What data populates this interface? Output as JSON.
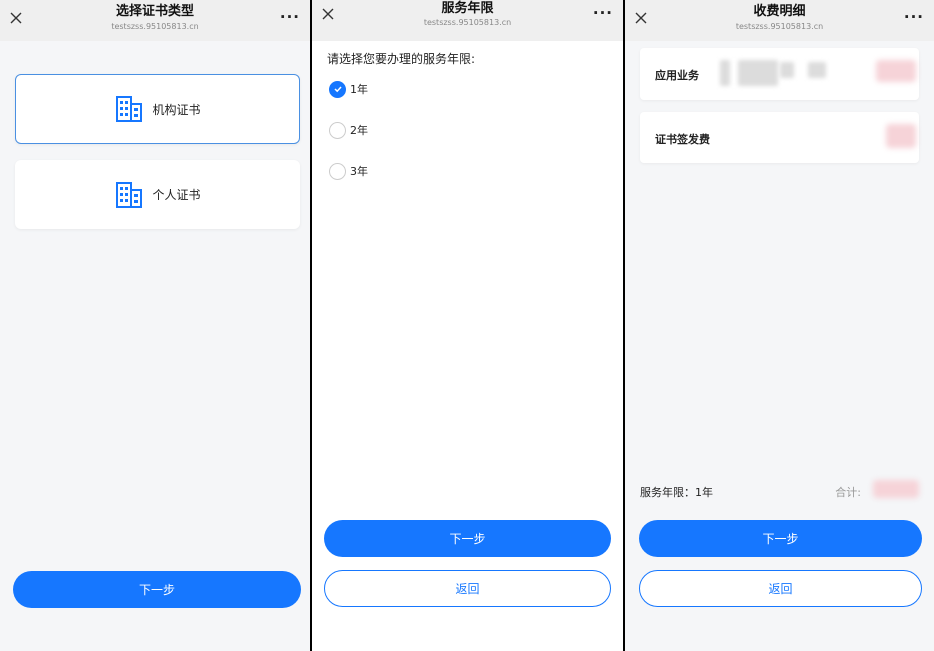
{
  "screen1": {
    "title": "选择证书类型",
    "url": "testszss.95105813.cn",
    "options": [
      {
        "label": "机构证书",
        "icon": "building-icon",
        "selected": true
      },
      {
        "label": "个人证书",
        "icon": "building-icon",
        "selected": false
      }
    ],
    "next_label": "下一步"
  },
  "screen2": {
    "title": "服务年限",
    "url": "testszss.95105813.cn",
    "question": "请选择您要办理的服务年限:",
    "options": [
      {
        "label": "1年",
        "checked": true
      },
      {
        "label": "2年",
        "checked": false
      },
      {
        "label": "3年",
        "checked": false
      }
    ],
    "next_label": "下一步",
    "back_label": "返回"
  },
  "screen3": {
    "title": "收费明细",
    "url": "testszss.95105813.cn",
    "items": [
      {
        "label": "应用业务"
      },
      {
        "label": "证书签发费"
      }
    ],
    "service_years": "服务年限：1年",
    "total_label": "合计:",
    "next_label": "下一步",
    "back_label": "返回"
  },
  "colors": {
    "primary": "#1677ff",
    "selected_border": "#4a90e2",
    "titlebar": "#efefef"
  }
}
